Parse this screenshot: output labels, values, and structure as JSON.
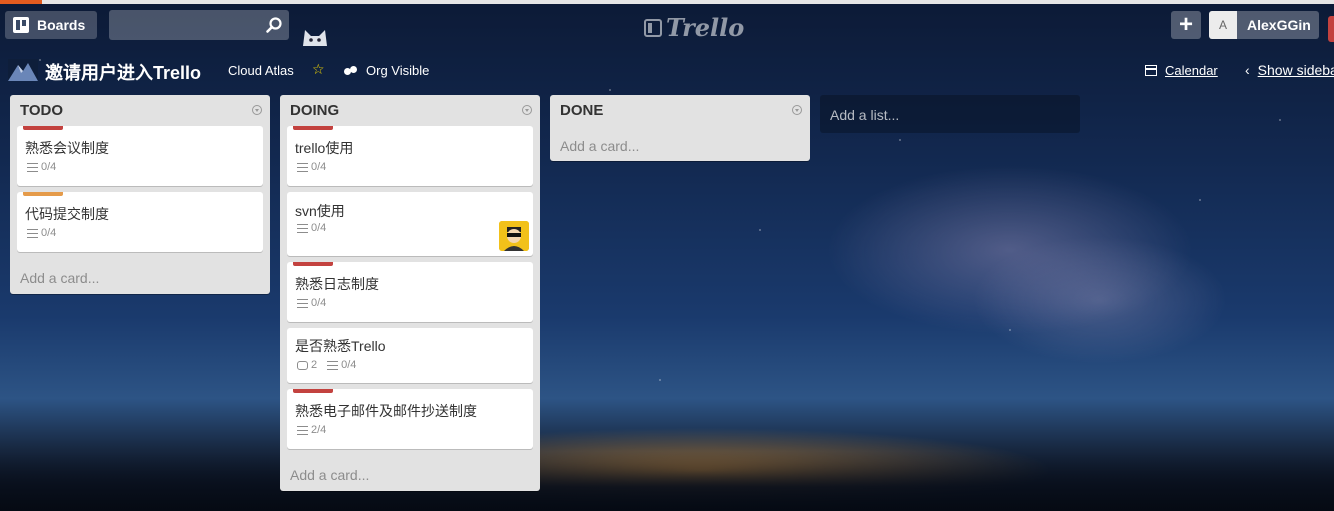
{
  "header": {
    "boards_label": "Boards",
    "search_value": "",
    "logo_text": "Trello",
    "add_label": "+",
    "member_initial": "A",
    "member_name": "AlexGGin"
  },
  "board": {
    "title": "邀请用户进入Trello",
    "org": "Cloud Atlas",
    "star": "☆",
    "visibility": "Org Visible",
    "calendar": "Calendar",
    "sidebar": "Show sidebar"
  },
  "colors": {
    "label_red": "#c3423f",
    "label_orange": "#e59b4a"
  },
  "lists": [
    {
      "title": "TODO",
      "cards": [
        {
          "title": "熟悉会议制度",
          "label": "red",
          "checklist": "0/4"
        },
        {
          "title": "代码提交制度",
          "label": "orange",
          "checklist": "0/4"
        }
      ],
      "add_card": "Add a card..."
    },
    {
      "title": "DOING",
      "cards": [
        {
          "title": "trello使用",
          "label": "red",
          "checklist": "0/4"
        },
        {
          "title": "svn使用",
          "checklist": "0/4",
          "member": true
        },
        {
          "title": "熟悉日志制度",
          "label": "red",
          "checklist": "0/4"
        },
        {
          "title": "是否熟悉Trello",
          "comments": "2",
          "checklist": "0/4"
        },
        {
          "title": "熟悉电子邮件及邮件抄送制度",
          "label": "red",
          "checklist": "2/4"
        }
      ],
      "add_card": "Add a card..."
    },
    {
      "title": "DONE",
      "cards": [],
      "add_card": "Add a card..."
    }
  ],
  "add_list": "Add a list..."
}
